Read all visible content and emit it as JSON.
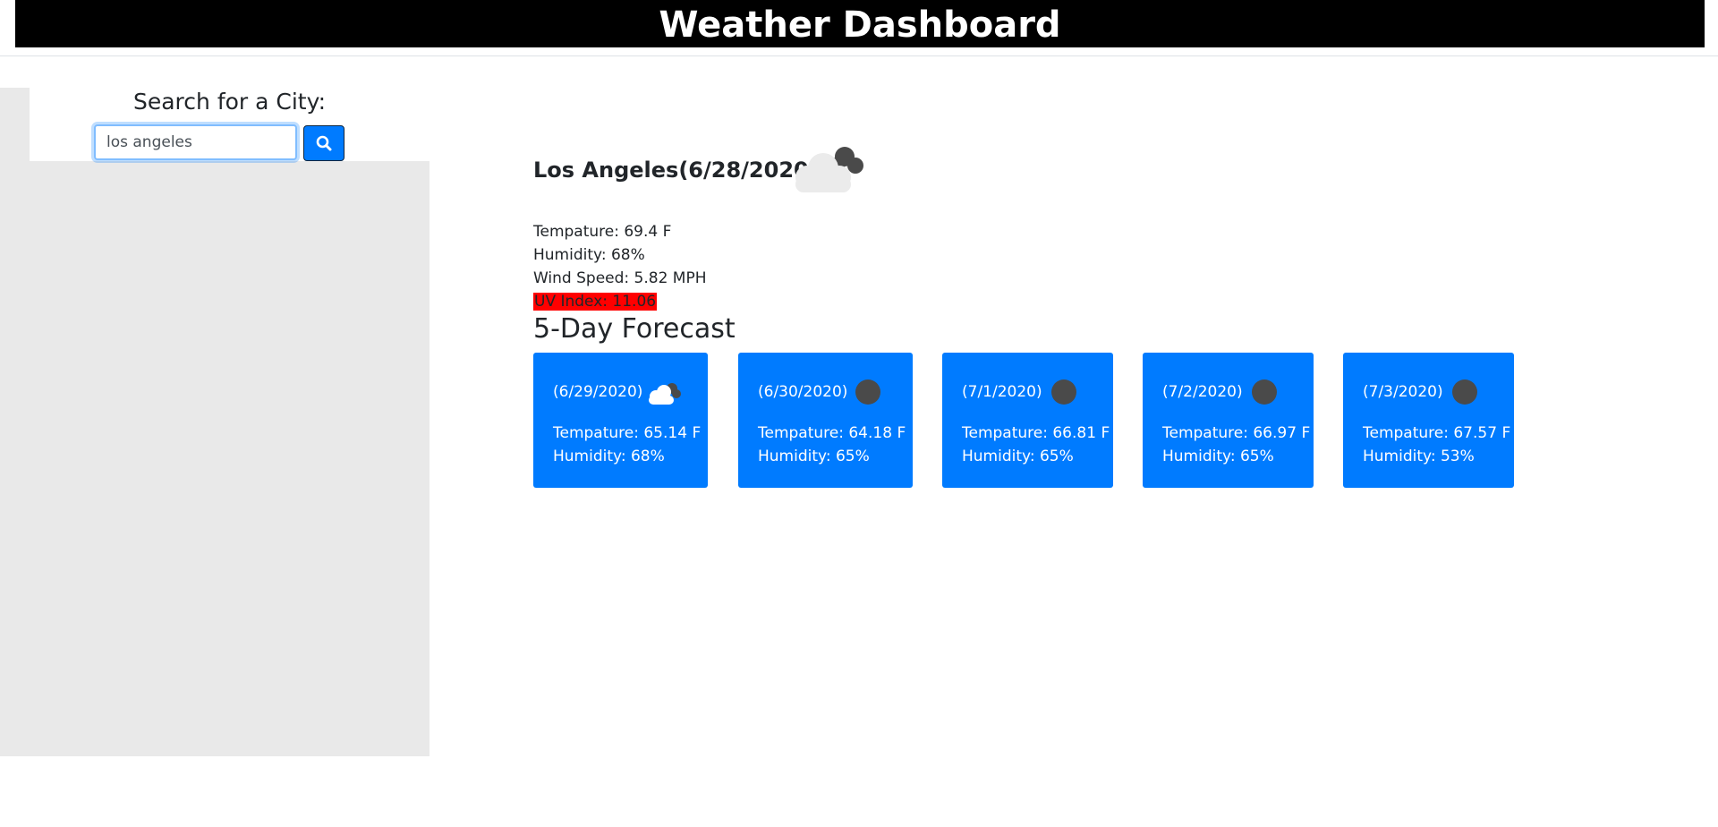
{
  "header": {
    "title": "Weather Dashboard"
  },
  "search": {
    "label": "Search for a City:",
    "value": "los angeles",
    "button_icon": "search-icon"
  },
  "current": {
    "title": "Los Angeles(6/28/2020)",
    "icon": "cloudy-icon",
    "temperature": "Tempature: 69.4 F",
    "humidity": "Humidity: 68%",
    "wind": "Wind Speed: 5.82 MPH",
    "uv": "UV Index: 11.06",
    "uv_color": "#ff0000"
  },
  "forecast": {
    "heading": "5-Day Forecast",
    "card_color": "#007bff",
    "days": [
      {
        "date": "(6/29/2020)",
        "icon": "cloudy-icon",
        "temp": "Tempature: 65.14 F",
        "humidity": "Humidity: 68%"
      },
      {
        "date": "(6/30/2020)",
        "icon": "clear-icon",
        "temp": "Tempature: 64.18 F",
        "humidity": "Humidity: 65%"
      },
      {
        "date": "(7/1/2020)",
        "icon": "clear-icon",
        "temp": "Tempature: 66.81 F",
        "humidity": "Humidity: 65%"
      },
      {
        "date": "(7/2/2020)",
        "icon": "clear-icon",
        "temp": "Tempature: 66.97 F",
        "humidity": "Humidity: 65%"
      },
      {
        "date": "(7/3/2020)",
        "icon": "clear-icon",
        "temp": "Tempature: 67.57 F",
        "humidity": "Humidity: 53%"
      }
    ]
  }
}
